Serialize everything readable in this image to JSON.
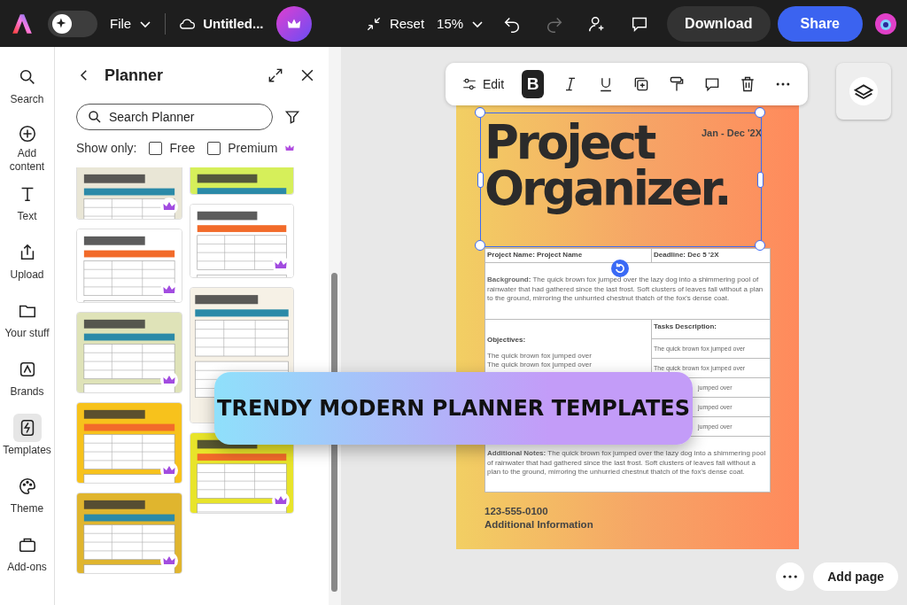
{
  "topbar": {
    "ai_toggle_on": false,
    "file_menu": "File",
    "document_name": "Untitled...",
    "reset": "Reset",
    "zoom": "15%",
    "download": "Download",
    "share": "Share",
    "redo_disabled": true
  },
  "rail": [
    {
      "label": "Search",
      "selected": false
    },
    {
      "label": "Add content",
      "selected": false
    },
    {
      "label": "Text",
      "selected": false
    },
    {
      "label": "Upload",
      "selected": false
    },
    {
      "label": "Your stuff",
      "selected": false
    },
    {
      "label": "Brands",
      "selected": false
    },
    {
      "label": "Templates",
      "selected": true
    },
    {
      "label": "Theme",
      "selected": false
    },
    {
      "label": "Add-ons",
      "selected": false
    }
  ],
  "panel": {
    "title": "Planner",
    "search": {
      "placeholder": "Search Planner"
    },
    "show_only": "Show only:",
    "filters": [
      {
        "label": "Free",
        "checked": false,
        "premium": false
      },
      {
        "label": "Premium",
        "checked": false,
        "premium": true
      }
    ],
    "templates": [
      [
        {
          "kind": "picture",
          "premium": true
        },
        {
          "kind": "picture",
          "premium": true
        },
        {
          "kind": "picture",
          "premium": true
        },
        {
          "kind": "picture",
          "premium": true
        },
        {
          "kind": "picture",
          "premium": true
        }
      ],
      [
        {
          "kind": "picture",
          "premium": false
        },
        {
          "kind": "picture",
          "premium": true
        },
        {
          "kind": "picture",
          "premium": false
        },
        {
          "kind": "picture",
          "premium": true
        }
      ]
    ]
  },
  "toolbar": {
    "edit": "Edit",
    "bold": "B",
    "bold_on": true
  },
  "document": {
    "title_lines": [
      "Project",
      "Organizer."
    ],
    "date": "Jan - Dec '2X",
    "project_name": "Project Name: Project Name",
    "deadline": "Deadline: Dec 5 '2X",
    "background": "**Background:** The quick brown fox jumped over the lazy dog into a shimmering pool of rainwater that had gathered since the last frost. Soft clusters of leaves fall without a plan to the ground, mirroring the unhurried chestnut thatch of the fox's dense coat.",
    "objectives_label": "Objectives:",
    "objectives": [
      "The quick brown fox jumped over",
      "The quick brown fox jumped over"
    ],
    "tasks_label": "Tasks Description:",
    "tasks": [
      {
        "text": "The quick brown fox jumped over",
        "covered": false
      },
      {
        "text": "The quick brown fox jumped over",
        "covered": false
      },
      {
        "text": "jumped over",
        "covered": true
      },
      {
        "text": "jumped over",
        "covered": true
      },
      {
        "text": "jumped over",
        "covered": true
      }
    ],
    "notes": "**Additional Notes:** The quick brown fox jumped over the lazy dog into a shimmering pool of rainwater that had gathered since the last frost. Soft clusters of leaves fall without a plan to the ground, mirroring the unhurried chestnut thatch of the fox's dense coat.",
    "phone": "123-555-0100",
    "info": "Additional Information"
  },
  "banner": "TRENDY MODERN PLANNER TEMPLATES",
  "add_page": "Add page"
}
